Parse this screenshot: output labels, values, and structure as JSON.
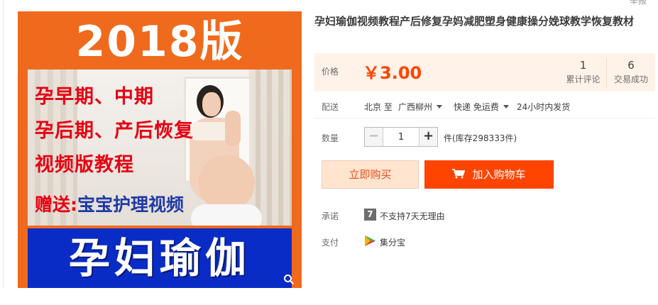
{
  "product_image": {
    "banner": "2018版",
    "lines": [
      "孕早期、中期",
      "孕后期、产后恢复",
      "视频版教程"
    ],
    "gift_prefix": "赠送:",
    "gift_text": "宝宝护理视频",
    "bottom": "孕妇瑜伽",
    "colors": {
      "banner_bg": "#f06a1d",
      "bottom_bg": "#0a2cc6",
      "red_text": "#e60012"
    }
  },
  "report_link": "举报",
  "title": "孕妇瑜伽视频教程产后修复孕妈减肥塑身健康操分娩球教学恢复教材",
  "price": {
    "label": "价格",
    "value": "￥3.00",
    "reviews_count": "1",
    "reviews_label": "累计评论",
    "sales_count": "6",
    "sales_label": "交易成功"
  },
  "delivery": {
    "label": "配送",
    "from": "北京 至",
    "to": "广西柳州",
    "shipping": "快递 免运费",
    "dispatch": "24小时内发货"
  },
  "quantity": {
    "label": "数量",
    "value": "1",
    "minus": "−",
    "plus": "+",
    "stock_text": "件(库存298333件)"
  },
  "buttons": {
    "buy_now": "立即购买",
    "add_to_cart": "加入购物车"
  },
  "promise": {
    "label": "承诺",
    "badge": "7",
    "text": "不支持7天无理由"
  },
  "payment": {
    "label": "支付",
    "text": "集分宝"
  },
  "colors": {
    "accent": "#ff4400",
    "price": "#ff4400",
    "price_bg": "#fff2e8"
  },
  "icons": [
    "zoom-icon",
    "cart-icon",
    "seven-day-icon",
    "jifenbao-icon",
    "caret-down-icon"
  ]
}
